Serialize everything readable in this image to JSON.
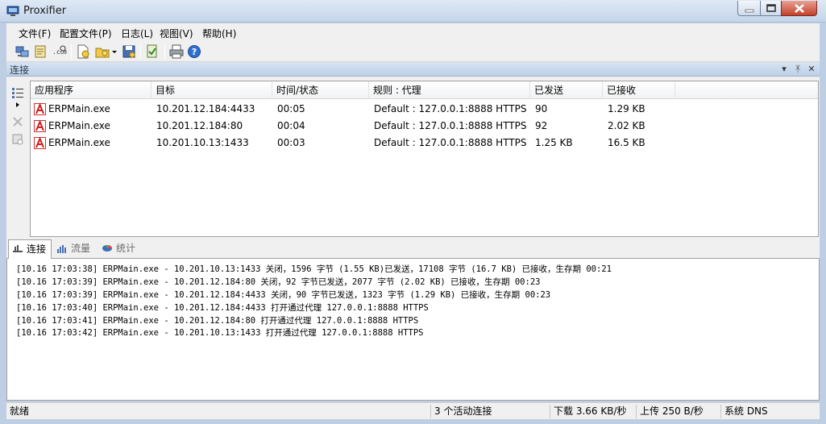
{
  "window": {
    "title": "Proxifier"
  },
  "menu": [
    "文件(F)",
    "配置文件(P)",
    "日志(L)",
    "视图(V)",
    "帮助(H)"
  ],
  "pane": {
    "title": "连接"
  },
  "connections": {
    "columns": [
      "应用程序",
      "目标",
      "时间/状态",
      "规则 : 代理",
      "已发送",
      "已接收"
    ],
    "rows": [
      {
        "app": "ERPMain.exe",
        "target": "10.201.12.184:4433",
        "time": "00:05",
        "rule": "Default : 127.0.0.1:8888 HTTPS",
        "sent": "90",
        "received": "1.29 KB"
      },
      {
        "app": "ERPMain.exe",
        "target": "10.201.12.184:80",
        "time": "00:04",
        "rule": "Default : 127.0.0.1:8888 HTTPS",
        "sent": "92",
        "received": "2.02 KB"
      },
      {
        "app": "ERPMain.exe",
        "target": "10.201.10.13:1433",
        "time": "00:03",
        "rule": "Default : 127.0.0.1:8888 HTTPS",
        "sent": "1.25 KB",
        "received": "16.5 KB"
      }
    ]
  },
  "tabs": [
    "连接",
    "流量",
    "统计"
  ],
  "log": [
    "[10.16 17:03:38] ERPMain.exe - 10.201.10.13:1433 关闭，1596 字节 (1.55 KB)已发送，17108 字节 (16.7 KB) 已接收，生存期 00:21",
    "[10.16 17:03:39] ERPMain.exe - 10.201.12.184:80 关闭，92 字节已发送，2077 字节 (2.02 KB) 已接收，生存期 00:23",
    "[10.16 17:03:39] ERPMain.exe - 10.201.12.184:4433 关闭，90 字节已发送，1323 字节 (1.29 KB) 已接收，生存期 00:23",
    "[10.16 17:03:40] ERPMain.exe - 10.201.12.184:4433 打开通过代理 127.0.0.1:8888 HTTPS",
    "[10.16 17:03:41] ERPMain.exe - 10.201.12.184:80 打开通过代理 127.0.0.1:8888 HTTPS",
    "[10.16 17:03:42] ERPMain.exe - 10.201.10.13:1433 打开通过代理 127.0.0.1:8888 HTTPS"
  ],
  "status": {
    "ready": "就绪",
    "active": "3 个活动连接",
    "download": "下载 3.66 KB/秒",
    "upload": "上传 250 B/秒",
    "dns": "系统 DNS"
  },
  "icons": {
    "app_icon": "proxifier-app-icon",
    "row_icon": "erp-app-icon",
    "toolbar": [
      "connect-icon",
      "profile-icon",
      "resolve-icon",
      "new-profile-icon",
      "open-profile-icon",
      "dropdown-arrow-icon",
      "save-profile-icon",
      "proxy-check-icon",
      "print-icon",
      "help-icon"
    ]
  },
  "colors": {
    "accent": "#2f5fa7",
    "title_gradient_top": "#dfe9f5",
    "close_red": "#c4402c"
  }
}
